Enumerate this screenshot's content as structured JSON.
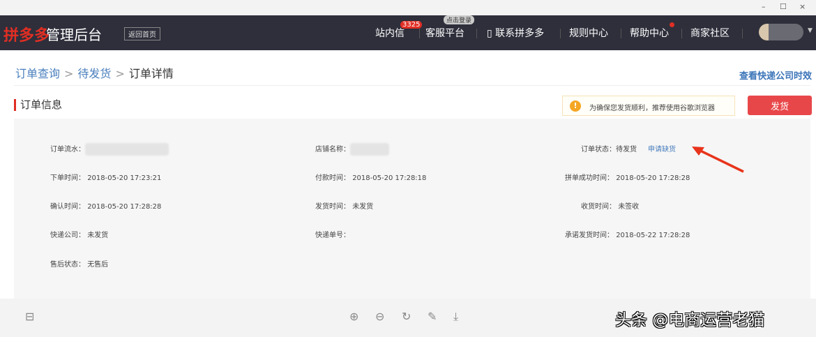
{
  "window": {
    "minimize": "–",
    "maximize": "☐",
    "close": "×"
  },
  "nav": {
    "logo": "拼多多",
    "title": "管理后台",
    "home": "返回首页",
    "items": [
      "站内信",
      "客服平台",
      "联系拼多多",
      "规则中心",
      "帮助中心",
      "商家社区"
    ],
    "badge": "3325",
    "tooltip": "点击登录"
  },
  "breadcrumb": [
    "订单查询",
    "待发货",
    "订单详情"
  ],
  "express_link": "查看快递公司时效",
  "section_title": "订单信息",
  "notice": "为确保您发货顺利，推荐使用谷歌浏览器",
  "ship_button": "发货",
  "fields": {
    "serial_label": "订单流水：",
    "shop_label": "店铺名称：",
    "status_label": "订单状态：",
    "status": "待发货",
    "apply_link": "申请缺货",
    "order_time_label": "下单时间：",
    "order_time": "2018-05-20 17:23:21",
    "pay_time_label": "付款时间：",
    "pay_time": "2018-05-20 17:28:18",
    "group_time_label": "拼单成功时间：",
    "group_time": "2018-05-20 17:28:28",
    "confirm_time_label": "确认时间：",
    "confirm_time": "2018-05-20 17:28:28",
    "ship_time_label": "发货时间：",
    "ship_time": "未发货",
    "receive_time_label": "收货时间：",
    "receive_time": "未签收",
    "courier_label": "快递公司：",
    "courier": "未发货",
    "tracking_label": "快递单号：",
    "promise_label": "承诺发货时间：",
    "promise_time": "2018-05-22 17:28:28",
    "aftersale_label": "售后状态：",
    "aftersale": "无售后"
  },
  "watermark": "头条 @电商运营老猫"
}
